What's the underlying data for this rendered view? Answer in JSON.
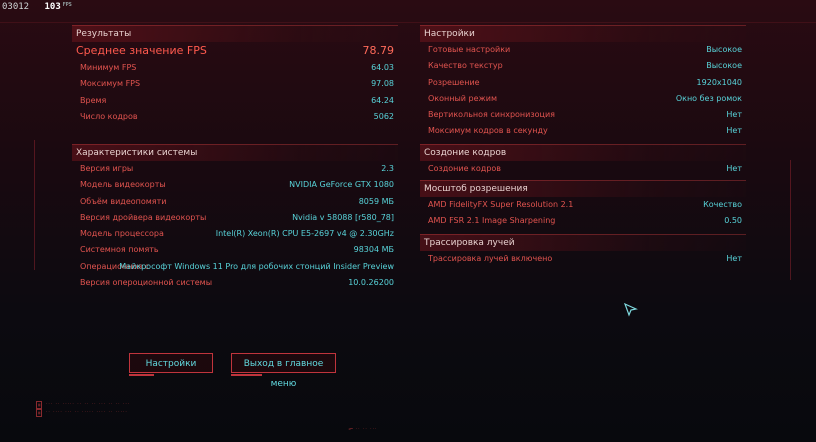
{
  "hud": {
    "counter": "03012",
    "fps_value": "103",
    "fps_unit": "FPS"
  },
  "results": {
    "title": "Результаты",
    "avg_label": "Среднее значение FPS",
    "avg_value": "78.79",
    "rows": [
      {
        "label": "Минимум FPS",
        "value": "64.03"
      },
      {
        "label": "Моксимум FPS",
        "value": "97.08"
      },
      {
        "label": "Время",
        "value": "64.24"
      },
      {
        "label": "Число кодров",
        "value": "5062"
      }
    ]
  },
  "system": {
    "title": "Характеристики системы",
    "rows": [
      {
        "label": "Версия игры",
        "value": "2.3"
      },
      {
        "label": "Модель видеокорты",
        "value": "NVIDIA GeForce GTX 1080"
      },
      {
        "label": "Объём видеопомяти",
        "value": "8059 МБ"
      },
      {
        "label": "Версия дройвера видеокорты",
        "value": "Nvidia v 58088 [r580_78]"
      },
      {
        "label": "Модель процессора",
        "value": "Intel(R) Xeon(R) CPU E5-2697 v4 @ 2.30GHz"
      },
      {
        "label": "Системноя помять",
        "value": "98304 МБ"
      },
      {
        "label": "Операционноя с",
        "value": "Майкрософт Windows 11 Pro для робочих стонций Insider Preview"
      },
      {
        "label": "Версия оперoционной системы",
        "value": "10.0.26200"
      }
    ]
  },
  "settings": {
    "title": "Настройки",
    "rows": [
      {
        "label": "Готовые настройки",
        "value": "Высокое"
      },
      {
        "label": "Качество текстур",
        "value": "Высокое"
      },
      {
        "label": "Розрешение",
        "value": "1920x1040"
      },
      {
        "label": "Оконный режим",
        "value": "Окно без ромок"
      },
      {
        "label": "Вертикольноя синхронизоция",
        "value": "Нет"
      },
      {
        "label": "Моксимум кодров в секунду",
        "value": "Нет"
      }
    ]
  },
  "framegen": {
    "title": "Создоние кодров",
    "rows": [
      {
        "label": "Создоние кодров",
        "value": "Нет"
      }
    ]
  },
  "scaling": {
    "title": "Мосштоб розрешения",
    "rows": [
      {
        "label": "AMD FidelityFX Super Resolution 2.1",
        "value": "Кочество"
      },
      {
        "label": "AMD FSR 2.1 Image Sharpening",
        "value": "0.50"
      }
    ]
  },
  "raytracing": {
    "title": "Трассировка лучей",
    "rows": [
      {
        "label": "Трассировка лучей включено",
        "value": "Нет"
      }
    ]
  },
  "buttons": {
    "settings": "Настройки",
    "main_menu": "Выход в главное меню"
  },
  "colors": {
    "label": "#e2544f",
    "value": "#58d3d9",
    "accent": "#c0343c"
  }
}
